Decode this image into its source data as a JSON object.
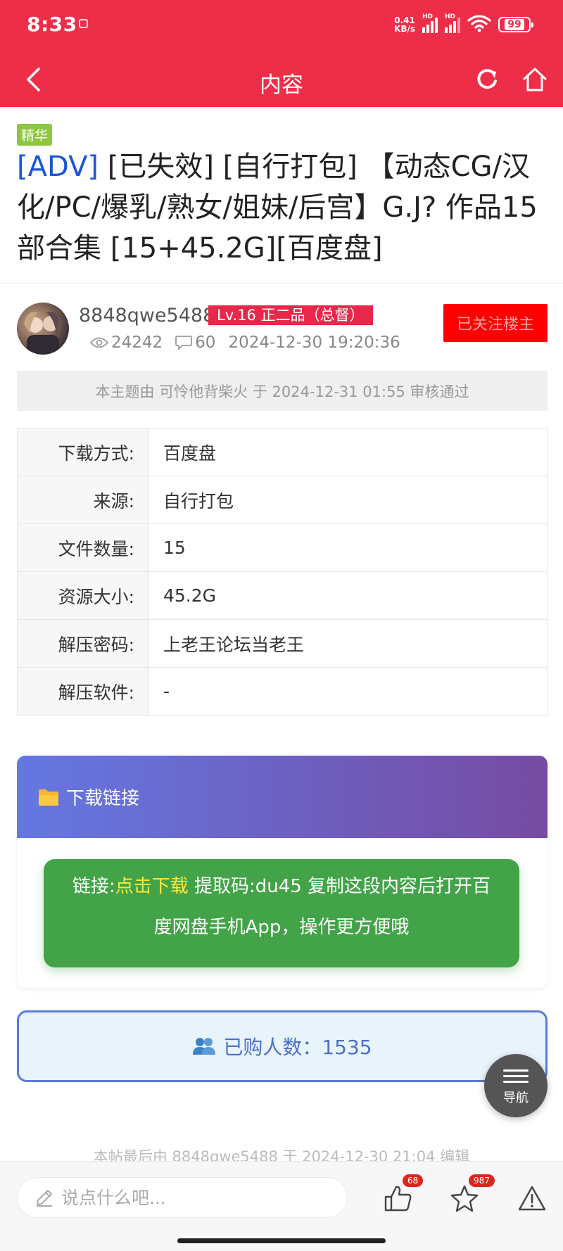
{
  "status_bar": {
    "time": "8:33",
    "net_speed_value": "0.41",
    "net_speed_unit": "KB/s",
    "hd1": "HD",
    "hd2": "HD",
    "battery": "99"
  },
  "nav": {
    "title": "内容"
  },
  "post": {
    "badge": "精华",
    "title_tag": "[ADV]",
    "title_rest": " [已失效] [自行打包] 【动态CG/汉化/PC/爆乳/熟女/姐妹/后宫】G.J? 作品15部合集 [15+45.2G][百度盘]"
  },
  "author": {
    "name": "8848qwe5488",
    "level": "Lv.16 正二品（总督）",
    "follow_label": "已关注楼主",
    "views": "24242",
    "comments": "60",
    "datetime": "2024-12-30 19:20:36"
  },
  "audit_text": "本主题由 可怜他背柴火 于 2024-12-31 01:55 审核通过",
  "info": [
    {
      "key": "下载方式:",
      "value": "百度盘"
    },
    {
      "key": "来源:",
      "value": "自行打包"
    },
    {
      "key": "文件数量:",
      "value": "15"
    },
    {
      "key": "资源大小:",
      "value": "45.2G"
    },
    {
      "key": "解压密码:",
      "value": "上老王论坛当老王"
    },
    {
      "key": "解压软件:",
      "value": "-"
    }
  ],
  "download": {
    "header": "下载链接",
    "link_prefix": "链接:",
    "link_text": "点击下载",
    "rest": " 提取码:du45 复制这段内容后打开百度网盘手机App，操作更方便哦"
  },
  "buyers": {
    "label": "已购人数：1535"
  },
  "float_nav": {
    "label": "导航"
  },
  "edit_note": "本帖最后由 8848qwe5488 于 2024-12-30 21:04 编辑",
  "bottom": {
    "placeholder": "说点什么吧...",
    "likes": "68",
    "favorites": "987"
  },
  "colors": {
    "brand_red": "#ee2e49",
    "essence_green": "#8dc63f",
    "link_blue": "#1a56d8",
    "download_green": "#43a348",
    "link_yellow": "#ffe83b"
  }
}
